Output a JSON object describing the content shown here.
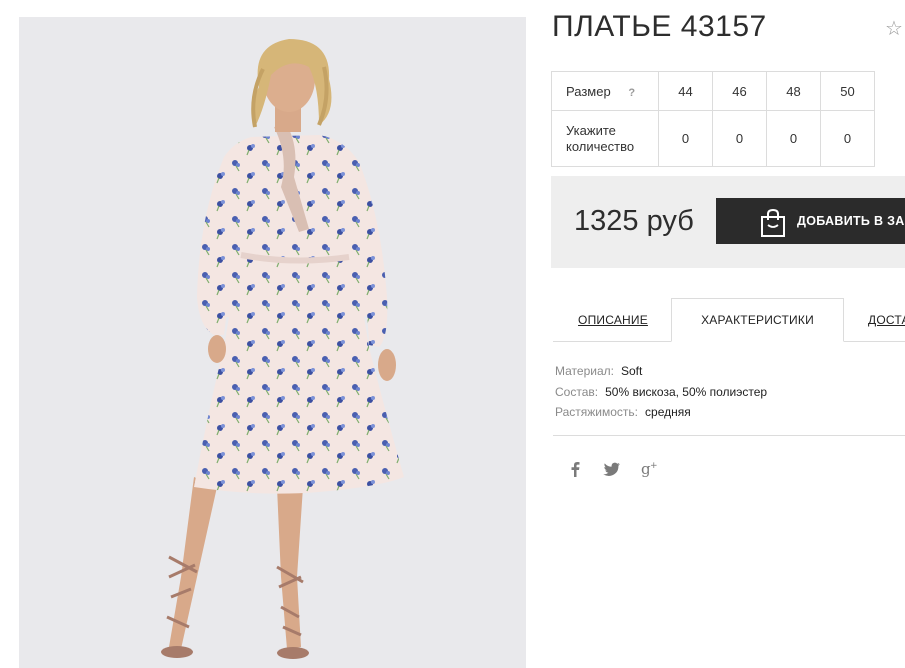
{
  "product": {
    "title": "ПЛАТЬЕ 43157"
  },
  "sizes": {
    "size_label": "Размер",
    "help_mark": "?",
    "qty_label": "Укажите количество",
    "values": [
      "44",
      "46",
      "48",
      "50"
    ],
    "quantities": [
      "0",
      "0",
      "0",
      "0"
    ]
  },
  "price": {
    "amount": "1325 руб",
    "add_button": "ДОБАВИТЬ В ЗАКАЗ"
  },
  "tabs": [
    {
      "label": "ОПИСАНИЕ"
    },
    {
      "label": "ХАРАКТЕРИСТИКИ",
      "active": true
    },
    {
      "label": "ДОСТАВКА"
    }
  ],
  "characteristics": [
    {
      "key": "Материал:",
      "value": "Soft"
    },
    {
      "key": "Состав:",
      "value": "50% вискоза, 50% полиэстер"
    },
    {
      "key": "Растяжимость:",
      "value": "средняя"
    }
  ],
  "social": [
    "facebook-icon",
    "twitter-icon",
    "google-plus-icon"
  ],
  "colors": {
    "button_bg": "#2b2b2b",
    "price_bg": "#eeeeee",
    "photo_bg": "#e9e9ec",
    "dress": "#f4e6e2",
    "flower": "#4a5fb0"
  }
}
